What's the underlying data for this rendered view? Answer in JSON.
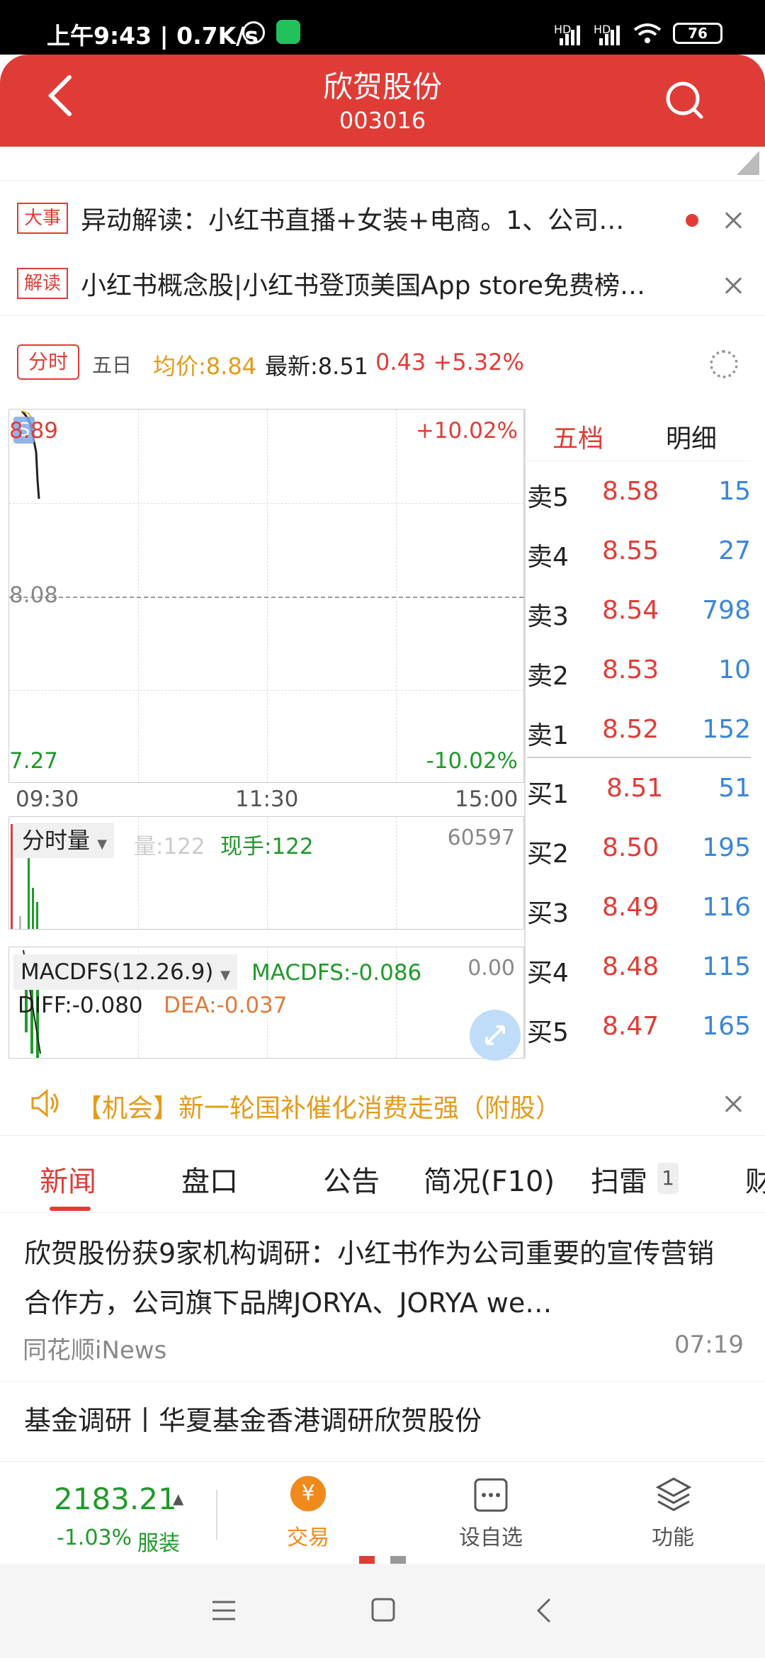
{
  "status_bar": {
    "time": "上午9:43 | 0.7K/s",
    "signal1": "HD",
    "signal2": "HD",
    "battery": "76"
  },
  "header": {
    "title": "欣贺股份",
    "code": "003016"
  },
  "alerts": [
    {
      "tag": "大事",
      "text": "异动解读：小红书直播+女装+电商。1、公司…"
    },
    {
      "tag": "解读",
      "text": "小红书概念股|小红书登顶美国App store免费榜…"
    }
  ],
  "quote": {
    "tab_fs": "分时",
    "tab_5d": "五日",
    "avg": "均价:8.84",
    "last": "最新:8.51",
    "change": "0.43 +5.32%"
  },
  "price_chart": {
    "y_high": "8.89",
    "y_mid": "8.08",
    "y_low": "7.27",
    "pct_high": "+10.02%",
    "pct_low": "-10.02%",
    "t_start": "09:30",
    "t_mid": "11:30",
    "t_end": "15:00",
    "s_marker": "S"
  },
  "volume_chart": {
    "selector": "分时量",
    "vol": "量:122",
    "now_hand": "现手:122",
    "max": "60597"
  },
  "macd_chart": {
    "selector": "MACDFS(12.26.9)",
    "macdfs": "MACDFS:-0.086",
    "zero": "0.00",
    "diff": "DIFF:-0.080",
    "dea": "DEA:-0.037"
  },
  "order_book": {
    "tab_five": "五档",
    "tab_detail": "明细",
    "asks": [
      {
        "label": "卖5",
        "price": "8.58",
        "vol": "15"
      },
      {
        "label": "卖4",
        "price": "8.55",
        "vol": "27"
      },
      {
        "label": "卖3",
        "price": "8.54",
        "vol": "798"
      },
      {
        "label": "卖2",
        "price": "8.53",
        "vol": "10"
      },
      {
        "label": "卖1",
        "price": "8.52",
        "vol": "152"
      }
    ],
    "bids": [
      {
        "label": "买1",
        "price": "8.51",
        "vol": "51"
      },
      {
        "label": "买2",
        "price": "8.50",
        "vol": "195"
      },
      {
        "label": "买3",
        "price": "8.49",
        "vol": "116"
      },
      {
        "label": "买4",
        "price": "8.48",
        "vol": "115"
      },
      {
        "label": "买5",
        "price": "8.47",
        "vol": "165"
      }
    ]
  },
  "opportunity": {
    "text": "【机会】新一轮国补催化消费走强（附股）"
  },
  "news_tabs": {
    "news": "新闻",
    "pankou": "盘口",
    "notice": "公告",
    "f10": "简况(F10)",
    "scan": "扫雷",
    "scan_badge": "1",
    "fin": "财"
  },
  "news_items": [
    {
      "title": "欣贺股份获9家机构调研：小红书作为公司重要的宣传营销合作方，公司旗下品牌JORYA、JORYA we…",
      "source": "同花顺iNews",
      "time": "07:19"
    },
    {
      "title": "基金调研丨华夏基金香港调研欣贺股份"
    }
  ],
  "bottom": {
    "index_value": "2183.21",
    "index_change": "-1.03%",
    "index_name": "服装",
    "trade": "交易",
    "trade_icon": "¥",
    "watch": "设自选",
    "func": "功能"
  },
  "colors": {
    "red": "#e03c37",
    "green": "#1f9a2a",
    "blue": "#3a86d8",
    "orange": "#e49a1a"
  }
}
